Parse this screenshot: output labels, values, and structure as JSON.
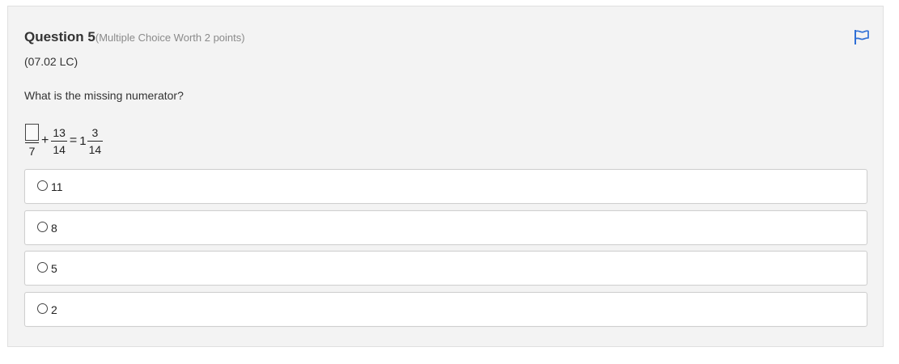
{
  "question": {
    "title": "Question 5",
    "worth": "(Multiple Choice Worth 2 points)",
    "code": "(07.02 LC)",
    "prompt": "What is the missing numerator?"
  },
  "flag": {
    "icon": "flag-icon",
    "color": "#2f6fd6"
  },
  "equation": {
    "frac1_den": "7",
    "plus": "+",
    "frac2_num": "13",
    "frac2_den": "14",
    "equals": "=",
    "whole": "1",
    "frac3_num": "3",
    "frac3_den": "14"
  },
  "options": [
    {
      "label": "11"
    },
    {
      "label": "8"
    },
    {
      "label": "5"
    },
    {
      "label": "2"
    }
  ]
}
